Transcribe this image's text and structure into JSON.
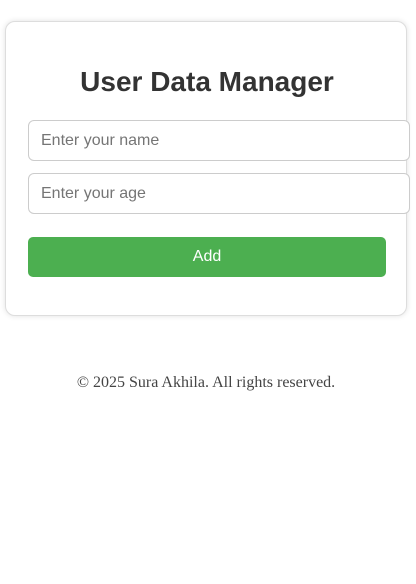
{
  "app": {
    "title": "User Data Manager"
  },
  "form": {
    "name_placeholder": "Enter your name",
    "name_value": "",
    "age_placeholder": "Enter your age",
    "age_value": "",
    "add_label": "Add"
  },
  "footer": {
    "text": "© 2025 Sura Akhila. All rights reserved."
  },
  "colors": {
    "accent": "#4caf50",
    "title_text": "#333333"
  }
}
